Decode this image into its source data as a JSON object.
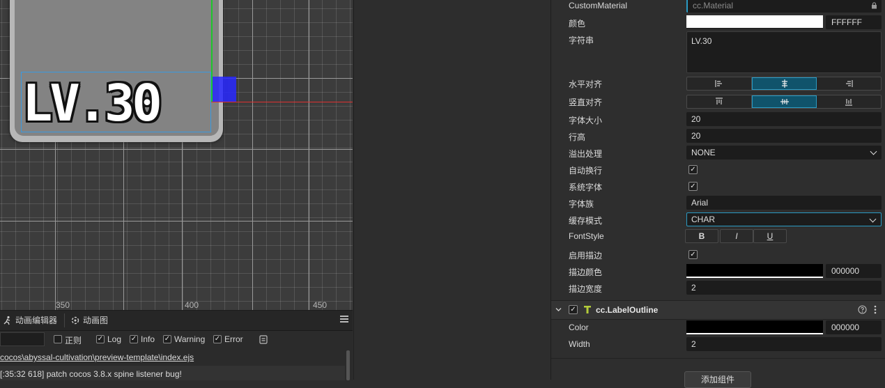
{
  "scene": {
    "label_text": "LV.30",
    "ruler": [
      "350",
      "400",
      "450"
    ]
  },
  "bottom_panel": {
    "tabs": [
      "动画编辑器",
      "动画图"
    ],
    "filters": [
      {
        "label": "正则",
        "checked": false
      },
      {
        "label": "Log",
        "checked": true
      },
      {
        "label": "Info",
        "checked": true
      },
      {
        "label": "Warning",
        "checked": true
      },
      {
        "label": "Error",
        "checked": true
      }
    ],
    "logs": [
      "cocos\\abyssal-cultivation\\preview-template\\index.ejs",
      "[:35:32 618] patch cocos 3.8.x spine listener bug!"
    ]
  },
  "inspector": {
    "custom_material_label": "CustomMaterial",
    "custom_material_value": "cc.Material",
    "color_label": "颜色",
    "color_hex": "FFFFFF",
    "color_value": "#ffffff",
    "string_label": "字符串",
    "string_value": "LV.30",
    "halign_label": "水平对齐",
    "valign_label": "竖直对齐",
    "font_size_label": "字体大小",
    "font_size_value": "20",
    "line_height_label": "行高",
    "line_height_value": "20",
    "overflow_label": "溢出处理",
    "overflow_value": "NONE",
    "wrap_label": "自动换行",
    "system_font_label": "系统字体",
    "font_family_label": "字体族",
    "font_family_value": "Arial",
    "cache_mode_label": "缓存模式",
    "cache_mode_value": "CHAR",
    "font_style_label": "FontStyle",
    "font_style_buttons": [
      "B",
      "I",
      "U"
    ],
    "outline_enable_label": "启用描边",
    "outline_color_label": "描边颜色",
    "outline_color_hex": "000000",
    "outline_width_label": "描边宽度",
    "outline_width_value": "2",
    "component_title": "cc.LabelOutline",
    "component_color_label": "Color",
    "component_color_hex": "000000",
    "component_width_label": "Width",
    "component_width_value": "2",
    "add_component_label": "添加组件"
  },
  "colors": {
    "accent": "#10536b",
    "accent_border": "#2a9bc4",
    "outline_color": "#000000"
  }
}
